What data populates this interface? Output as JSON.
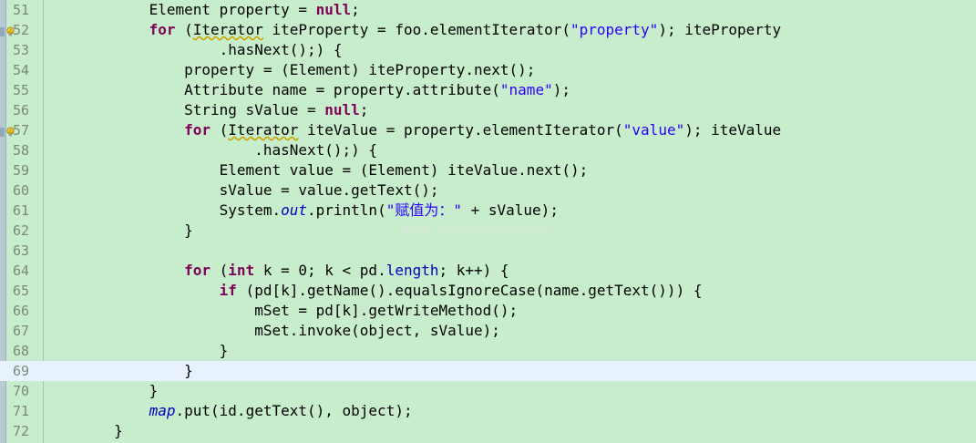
{
  "editor": {
    "watermark": "http://blog.csdn.net/",
    "current_line": "69",
    "lines": [
      {
        "n": "51",
        "indent": "            ",
        "tokens": [
          {
            "t": "Element property = "
          },
          {
            "t": "null",
            "c": "kw"
          },
          {
            "t": ";"
          }
        ]
      },
      {
        "n": "52",
        "indent": "            ",
        "marker": true,
        "tokens": [
          {
            "t": "for",
            "c": "kw"
          },
          {
            "t": " ("
          },
          {
            "t": "Iterator",
            "c": "warn"
          },
          {
            "t": " iteProperty = foo.elementIterator("
          },
          {
            "t": "\"property\"",
            "c": "str"
          },
          {
            "t": "); iteProperty"
          }
        ]
      },
      {
        "n": "53",
        "indent": "                    ",
        "tokens": [
          {
            "t": ".hasNext();) {"
          }
        ]
      },
      {
        "n": "54",
        "indent": "                ",
        "tokens": [
          {
            "t": "property = (Element) iteProperty.next();"
          }
        ]
      },
      {
        "n": "55",
        "indent": "                ",
        "tokens": [
          {
            "t": "Attribute name = property.attribute("
          },
          {
            "t": "\"name\"",
            "c": "str"
          },
          {
            "t": ");"
          }
        ]
      },
      {
        "n": "56",
        "indent": "                ",
        "tokens": [
          {
            "t": "String sValue = "
          },
          {
            "t": "null",
            "c": "kw"
          },
          {
            "t": ";"
          }
        ]
      },
      {
        "n": "57",
        "indent": "                ",
        "marker": true,
        "tokens": [
          {
            "t": "for",
            "c": "kw"
          },
          {
            "t": " ("
          },
          {
            "t": "Iterator",
            "c": "warn"
          },
          {
            "t": " iteValue = property.elementIterator("
          },
          {
            "t": "\"value\"",
            "c": "str"
          },
          {
            "t": "); iteValue"
          }
        ]
      },
      {
        "n": "58",
        "indent": "                        ",
        "tokens": [
          {
            "t": ".hasNext();) {"
          }
        ]
      },
      {
        "n": "59",
        "indent": "                    ",
        "tokens": [
          {
            "t": "Element value = (Element) iteValue.next();"
          }
        ]
      },
      {
        "n": "60",
        "indent": "                    ",
        "tokens": [
          {
            "t": "sValue = value.getText();"
          }
        ]
      },
      {
        "n": "61",
        "indent": "                    ",
        "tokens": [
          {
            "t": "System."
          },
          {
            "t": "out",
            "c": "sfld"
          },
          {
            "t": ".println("
          },
          {
            "t": "\"赋值为：\"",
            "c": "str"
          },
          {
            "t": " + sValue);"
          }
        ]
      },
      {
        "n": "62",
        "indent": "                ",
        "tokens": [
          {
            "t": "}"
          }
        ]
      },
      {
        "n": "63",
        "indent": "",
        "tokens": [
          {
            "t": ""
          }
        ]
      },
      {
        "n": "64",
        "indent": "                ",
        "tokens": [
          {
            "t": "for",
            "c": "kw"
          },
          {
            "t": " ("
          },
          {
            "t": "int",
            "c": "kw"
          },
          {
            "t": " k = 0; k < pd."
          },
          {
            "t": "length",
            "c": "fld"
          },
          {
            "t": "; k++) {"
          }
        ]
      },
      {
        "n": "65",
        "indent": "                    ",
        "tokens": [
          {
            "t": "if",
            "c": "kw"
          },
          {
            "t": " (pd[k].getName().equalsIgnoreCase(name.getText())) {"
          }
        ]
      },
      {
        "n": "66",
        "indent": "                        ",
        "tokens": [
          {
            "t": "mSet = pd[k].getWriteMethod();"
          }
        ]
      },
      {
        "n": "67",
        "indent": "                        ",
        "tokens": [
          {
            "t": "mSet.invoke(object, sValue);"
          }
        ]
      },
      {
        "n": "68",
        "indent": "                    ",
        "tokens": [
          {
            "t": "}"
          }
        ]
      },
      {
        "n": "69",
        "indent": "                ",
        "tokens": [
          {
            "t": "}"
          }
        ]
      },
      {
        "n": "70",
        "indent": "            ",
        "tokens": [
          {
            "t": "}"
          }
        ]
      },
      {
        "n": "71",
        "indent": "            ",
        "tokens": [
          {
            "t": "map",
            "c": "sfld"
          },
          {
            "t": ".put(id.getText(), object);"
          }
        ]
      },
      {
        "n": "72",
        "indent": "        ",
        "tokens": [
          {
            "t": "}"
          }
        ]
      }
    ]
  }
}
